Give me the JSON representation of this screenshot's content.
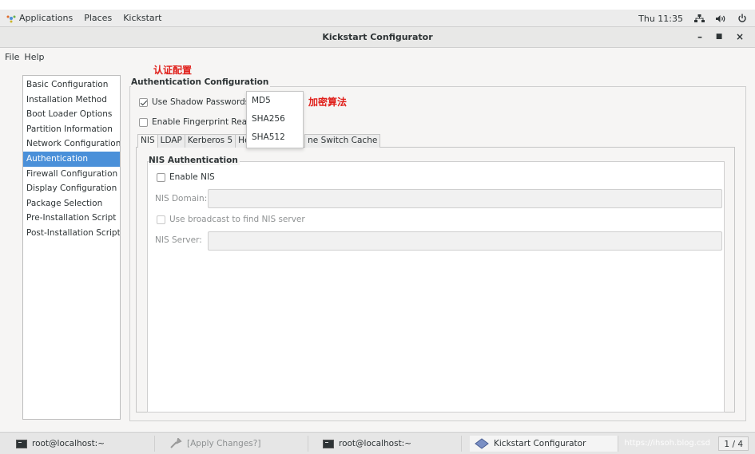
{
  "top_panel": {
    "applications": "Applications",
    "places": "Places",
    "app_name": "Kickstart",
    "clock": "Thu 11:35"
  },
  "window": {
    "title": "Kickstart Configurator"
  },
  "menu": {
    "file": "File",
    "help": "Help"
  },
  "sidebar": {
    "items": [
      {
        "label": "Basic Configuration"
      },
      {
        "label": "Installation Method"
      },
      {
        "label": "Boot Loader Options"
      },
      {
        "label": "Partition Information"
      },
      {
        "label": "Network Configuration"
      },
      {
        "label": "Authentication"
      },
      {
        "label": "Firewall Configuration"
      },
      {
        "label": "Display Configuration"
      },
      {
        "label": "Package Selection"
      },
      {
        "label": "Pre-Installation Script"
      },
      {
        "label": "Post-Installation Script"
      }
    ],
    "selected_index": 5
  },
  "annotations": {
    "auth_config": "认证配置",
    "encryption_algorithm": "加密算法"
  },
  "auth": {
    "frame_title": "Authentication Configuration",
    "shadow_label": "Use Shadow Passwords",
    "shadow_checked": true,
    "fingerprint_label": "Enable Fingerprint Reader",
    "fingerprint_checked": false,
    "hash_options": [
      "MD5",
      "SHA256",
      "SHA512"
    ]
  },
  "tabs": [
    {
      "label": "NIS"
    },
    {
      "label": "LDAP"
    },
    {
      "label": "Kerberos 5"
    },
    {
      "label": "He"
    },
    {
      "label": "ne Switch Cache"
    }
  ],
  "nis": {
    "frame_title": "NIS Authentication",
    "enable_label": "Enable NIS",
    "domain_label": "NIS Domain:",
    "domain_value": "",
    "broadcast_label": "Use broadcast to find NIS server",
    "server_label": "NIS Server:",
    "server_value": ""
  },
  "taskbar": {
    "tasks": [
      {
        "label": "root@localhost:~"
      },
      {
        "label": "[Apply Changes?]"
      },
      {
        "label": "root@localhost:~"
      },
      {
        "label": "Kickstart Configurator"
      }
    ],
    "watermark": "https://ihsoh.blog.csd",
    "pager": "1 / 4"
  }
}
